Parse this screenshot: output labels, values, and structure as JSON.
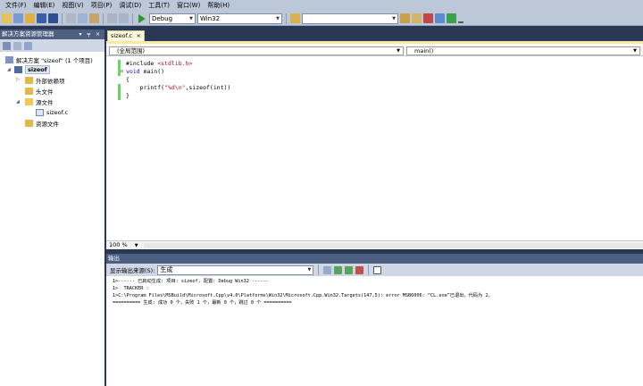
{
  "menu": {
    "items": [
      "文件(F)",
      "编辑(E)",
      "视图(V)",
      "项目(P)",
      "调试(D)",
      "工具(T)",
      "窗口(W)",
      "帮助(H)"
    ]
  },
  "toolbar": {
    "config_value": "Debug",
    "platform_value": "Win32",
    "search_value": ""
  },
  "solution_explorer": {
    "title": "解决方案资源管理器",
    "header_controls": "▾ ╤ ×",
    "tree": {
      "solution": "解决方案 \"sizeof\" (1 个项目)",
      "project": "sizeof",
      "external_deps": "外部依赖项",
      "header_files": "头文件",
      "source_files": "源文件",
      "source_file": "sizeof.c",
      "resource_files": "资源文件"
    }
  },
  "editor": {
    "tab_label": "sizeof.c",
    "tab_close": "×",
    "scope_combo": "(全局范围)",
    "member_combo": "main()",
    "code_lines": [
      {
        "pre": "#include ",
        "kw": "",
        "str": "<stdlib.h>",
        "post": ""
      },
      {
        "pre": "",
        "kw": "void",
        "str": "",
        "post": " main()"
      },
      {
        "pre": "{",
        "kw": "",
        "str": "",
        "post": ""
      },
      {
        "pre": "    printf(",
        "kw": "",
        "str": "\"%d\\n\"",
        "post": ",sizeof(int))"
      },
      {
        "pre": "}",
        "kw": "",
        "str": "",
        "post": ""
      }
    ],
    "zoom": "100 %"
  },
  "output": {
    "title": "输出",
    "source_label": "显示输出来源(S):",
    "source_value": "生成",
    "lines": [
      "1>------ 已启动生成: 项目: sizeof, 配置: Debug Win32 ------",
      "1>  TRACKER :",
      "1>C:\\Program Files\\MSBuild\\Microsoft.Cpp\\v4.0\\Platforms\\Win32\\Microsoft.Cpp.Win32.Targets(147,5): error MSB6006: “CL.exe”已退出，代码为 2。",
      "========== 生成: 成功 0 个，失败 1 个，最新 0 个，跳过 0 个 =========="
    ]
  },
  "colors": {
    "background": "#293955",
    "pane_header": "#4d6082",
    "keyword": "#0000ff",
    "string": "#a31515",
    "changed_line": "#6ad36a"
  }
}
